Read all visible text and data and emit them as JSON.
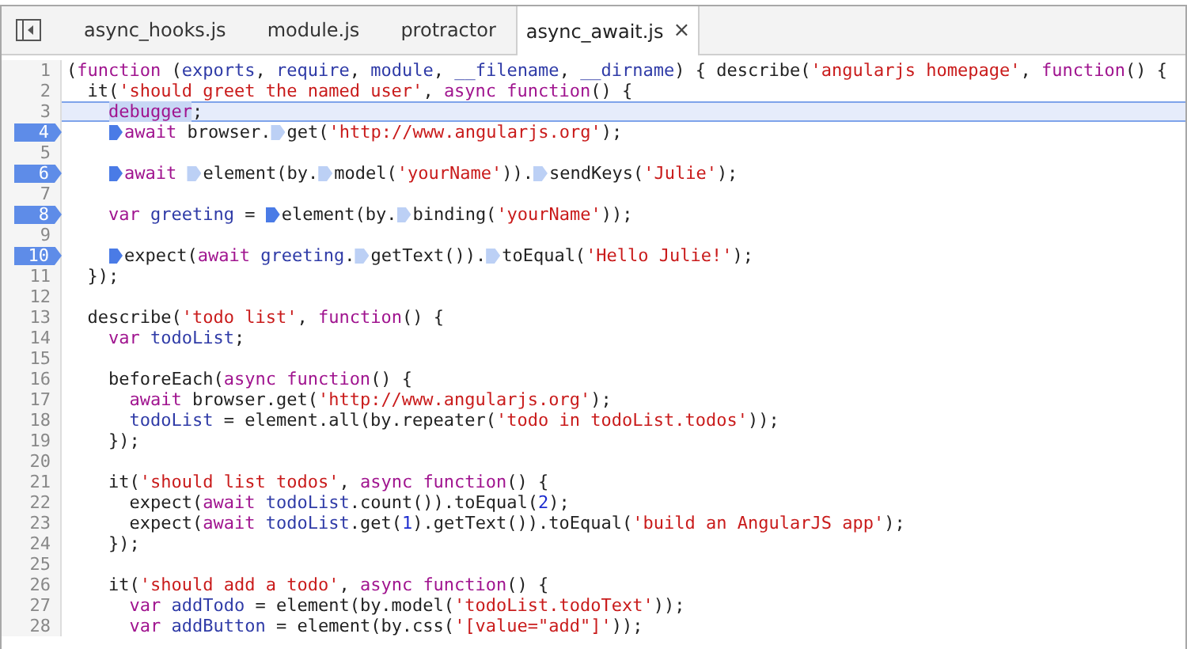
{
  "tabs": [
    {
      "label": "async_hooks.js",
      "selected": false
    },
    {
      "label": "module.js",
      "selected": false
    },
    {
      "label": "protractor",
      "selected": false
    },
    {
      "label": "async_await.js",
      "selected": true,
      "close": "×"
    }
  ],
  "lines": [
    {
      "number": "1",
      "breakpoint": false,
      "current": false,
      "tokens": [
        {
          "kind": "p",
          "text": "("
        },
        {
          "kind": "k",
          "text": "function"
        },
        {
          "kind": "p",
          "text": " ("
        },
        {
          "kind": "v",
          "text": "exports"
        },
        {
          "kind": "p",
          "text": ", "
        },
        {
          "kind": "v",
          "text": "require"
        },
        {
          "kind": "p",
          "text": ", "
        },
        {
          "kind": "v",
          "text": "module"
        },
        {
          "kind": "p",
          "text": ", "
        },
        {
          "kind": "v",
          "text": "__filename"
        },
        {
          "kind": "p",
          "text": ", "
        },
        {
          "kind": "v",
          "text": "__dirname"
        },
        {
          "kind": "p",
          "text": ") { describe("
        },
        {
          "kind": "s",
          "text": "'angularjs homepage'"
        },
        {
          "kind": "p",
          "text": ", "
        },
        {
          "kind": "k",
          "text": "function"
        },
        {
          "kind": "p",
          "text": "() {"
        }
      ]
    },
    {
      "number": "2",
      "breakpoint": false,
      "current": false,
      "tokens": [
        {
          "kind": "p",
          "text": "  it("
        },
        {
          "kind": "s",
          "text": "'should greet the named user'"
        },
        {
          "kind": "p",
          "text": ", "
        },
        {
          "kind": "k",
          "text": "async function"
        },
        {
          "kind": "p",
          "text": "() {"
        }
      ]
    },
    {
      "number": "3",
      "breakpoint": false,
      "current": true,
      "tokens": [
        {
          "kind": "k",
          "text": "    debugger",
          "selected": true
        },
        {
          "kind": "p",
          "text": ";"
        }
      ]
    },
    {
      "number": "4",
      "breakpoint": true,
      "current": false,
      "tokens": [
        {
          "kind": "k",
          "text": "    await",
          "marker_active": true
        },
        {
          "kind": "p",
          "text": " browser."
        },
        {
          "kind": "p",
          "text": "get(",
          "marker_active": false
        },
        {
          "kind": "s",
          "text": "'http://www.angularjs.org'"
        },
        {
          "kind": "p",
          "text": ");"
        }
      ]
    },
    {
      "number": "5",
      "breakpoint": false,
      "current": false
    },
    {
      "number": "6",
      "breakpoint": true,
      "current": false,
      "tokens": [
        {
          "kind": "k",
          "text": "    await",
          "marker_active": true
        },
        {
          "kind": "p",
          "text": " element(by.",
          "marker_active": false
        },
        {
          "kind": "p",
          "text": "model(",
          "marker_active": false
        },
        {
          "kind": "s",
          "text": "'yourName'"
        },
        {
          "kind": "p",
          "text": "))."
        },
        {
          "kind": "p",
          "text": "sendKeys(",
          "marker_active": false
        },
        {
          "kind": "s",
          "text": "'Julie'"
        },
        {
          "kind": "p",
          "text": ");"
        }
      ]
    },
    {
      "number": "7",
      "breakpoint": false,
      "current": false
    },
    {
      "number": "8",
      "breakpoint": true,
      "current": false,
      "tokens": [
        {
          "kind": "k",
          "text": "    var"
        },
        {
          "kind": "v",
          "text": " greeting"
        },
        {
          "kind": "p",
          "text": " ="
        },
        {
          "kind": "p",
          "text": " element(by.",
          "marker_active": true
        },
        {
          "kind": "p",
          "text": "binding(",
          "marker_active": false
        },
        {
          "kind": "s",
          "text": "'yourName'"
        },
        {
          "kind": "p",
          "text": "));"
        }
      ]
    },
    {
      "number": "9",
      "breakpoint": false,
      "current": false
    },
    {
      "number": "10",
      "breakpoint": true,
      "current": false,
      "tokens": [
        {
          "kind": "p",
          "text": "    expect(",
          "marker_active": true
        },
        {
          "kind": "k",
          "text": "await"
        },
        {
          "kind": "v",
          "text": " greeting"
        },
        {
          "kind": "p",
          "text": "."
        },
        {
          "kind": "p",
          "text": "getText()).",
          "marker_active": false
        },
        {
          "kind": "p",
          "text": "toEqual(",
          "marker_active": false
        },
        {
          "kind": "s",
          "text": "'Hello Julie!'"
        },
        {
          "kind": "p",
          "text": ");"
        }
      ]
    },
    {
      "number": "11",
      "breakpoint": false,
      "current": false,
      "tokens": [
        {
          "kind": "p",
          "text": "  });"
        }
      ]
    },
    {
      "number": "12",
      "breakpoint": false,
      "current": false
    },
    {
      "number": "13",
      "breakpoint": false,
      "current": false,
      "tokens": [
        {
          "kind": "p",
          "text": "  describe("
        },
        {
          "kind": "s",
          "text": "'todo list'"
        },
        {
          "kind": "p",
          "text": ", "
        },
        {
          "kind": "k",
          "text": "function"
        },
        {
          "kind": "p",
          "text": "() {"
        }
      ]
    },
    {
      "number": "14",
      "breakpoint": false,
      "current": false,
      "tokens": [
        {
          "kind": "k",
          "text": "    var"
        },
        {
          "kind": "v",
          "text": " todoList"
        },
        {
          "kind": "p",
          "text": ";"
        }
      ]
    },
    {
      "number": "15",
      "breakpoint": false,
      "current": false
    },
    {
      "number": "16",
      "breakpoint": false,
      "current": false,
      "tokens": [
        {
          "kind": "p",
          "text": "    beforeEach("
        },
        {
          "kind": "k",
          "text": "async function"
        },
        {
          "kind": "p",
          "text": "() {"
        }
      ]
    },
    {
      "number": "17",
      "breakpoint": false,
      "current": false,
      "tokens": [
        {
          "kind": "k",
          "text": "      await"
        },
        {
          "kind": "p",
          "text": " browser.get("
        },
        {
          "kind": "s",
          "text": "'http://www.angularjs.org'"
        },
        {
          "kind": "p",
          "text": ");"
        }
      ]
    },
    {
      "number": "18",
      "breakpoint": false,
      "current": false,
      "tokens": [
        {
          "kind": "v",
          "text": "      todoList"
        },
        {
          "kind": "p",
          "text": " = element.all(by.repeater("
        },
        {
          "kind": "s",
          "text": "'todo in todoList.todos'"
        },
        {
          "kind": "p",
          "text": "));"
        }
      ]
    },
    {
      "number": "19",
      "breakpoint": false,
      "current": false,
      "tokens": [
        {
          "kind": "p",
          "text": "    });"
        }
      ]
    },
    {
      "number": "20",
      "breakpoint": false,
      "current": false
    },
    {
      "number": "21",
      "breakpoint": false,
      "current": false,
      "tokens": [
        {
          "kind": "p",
          "text": "    it("
        },
        {
          "kind": "s",
          "text": "'should list todos'"
        },
        {
          "kind": "p",
          "text": ", "
        },
        {
          "kind": "k",
          "text": "async function"
        },
        {
          "kind": "p",
          "text": "() {"
        }
      ]
    },
    {
      "number": "22",
      "breakpoint": false,
      "current": false,
      "tokens": [
        {
          "kind": "p",
          "text": "      expect("
        },
        {
          "kind": "k",
          "text": "await"
        },
        {
          "kind": "v",
          "text": " todoList"
        },
        {
          "kind": "p",
          "text": ".count()).toEqual("
        },
        {
          "kind": "n",
          "text": "2"
        },
        {
          "kind": "p",
          "text": ");"
        }
      ]
    },
    {
      "number": "23",
      "breakpoint": false,
      "current": false,
      "tokens": [
        {
          "kind": "p",
          "text": "      expect("
        },
        {
          "kind": "k",
          "text": "await"
        },
        {
          "kind": "v",
          "text": " todoList"
        },
        {
          "kind": "p",
          "text": ".get("
        },
        {
          "kind": "n",
          "text": "1"
        },
        {
          "kind": "p",
          "text": ").getText()).toEqual("
        },
        {
          "kind": "s",
          "text": "'build an AngularJS app'"
        },
        {
          "kind": "p",
          "text": ");"
        }
      ]
    },
    {
      "number": "24",
      "breakpoint": false,
      "current": false,
      "tokens": [
        {
          "kind": "p",
          "text": "    });"
        }
      ]
    },
    {
      "number": "25",
      "breakpoint": false,
      "current": false
    },
    {
      "number": "26",
      "breakpoint": false,
      "current": false,
      "tokens": [
        {
          "kind": "p",
          "text": "    it("
        },
        {
          "kind": "s",
          "text": "'should add a todo'"
        },
        {
          "kind": "p",
          "text": ", "
        },
        {
          "kind": "k",
          "text": "async function"
        },
        {
          "kind": "p",
          "text": "() {"
        }
      ]
    },
    {
      "number": "27",
      "breakpoint": false,
      "current": false,
      "tokens": [
        {
          "kind": "k",
          "text": "      var"
        },
        {
          "kind": "v",
          "text": " addTodo"
        },
        {
          "kind": "p",
          "text": " = element(by.model("
        },
        {
          "kind": "s",
          "text": "'todoList.todoText'"
        },
        {
          "kind": "p",
          "text": "));"
        }
      ]
    },
    {
      "number": "28",
      "breakpoint": false,
      "current": false,
      "tokens": [
        {
          "kind": "k",
          "text": "      var"
        },
        {
          "kind": "v",
          "text": " addButton"
        },
        {
          "kind": "p",
          "text": " = element(by.css("
        },
        {
          "kind": "s",
          "text": "'[value=\"add\"]'"
        },
        {
          "kind": "p",
          "text": "));"
        }
      ]
    }
  ]
}
